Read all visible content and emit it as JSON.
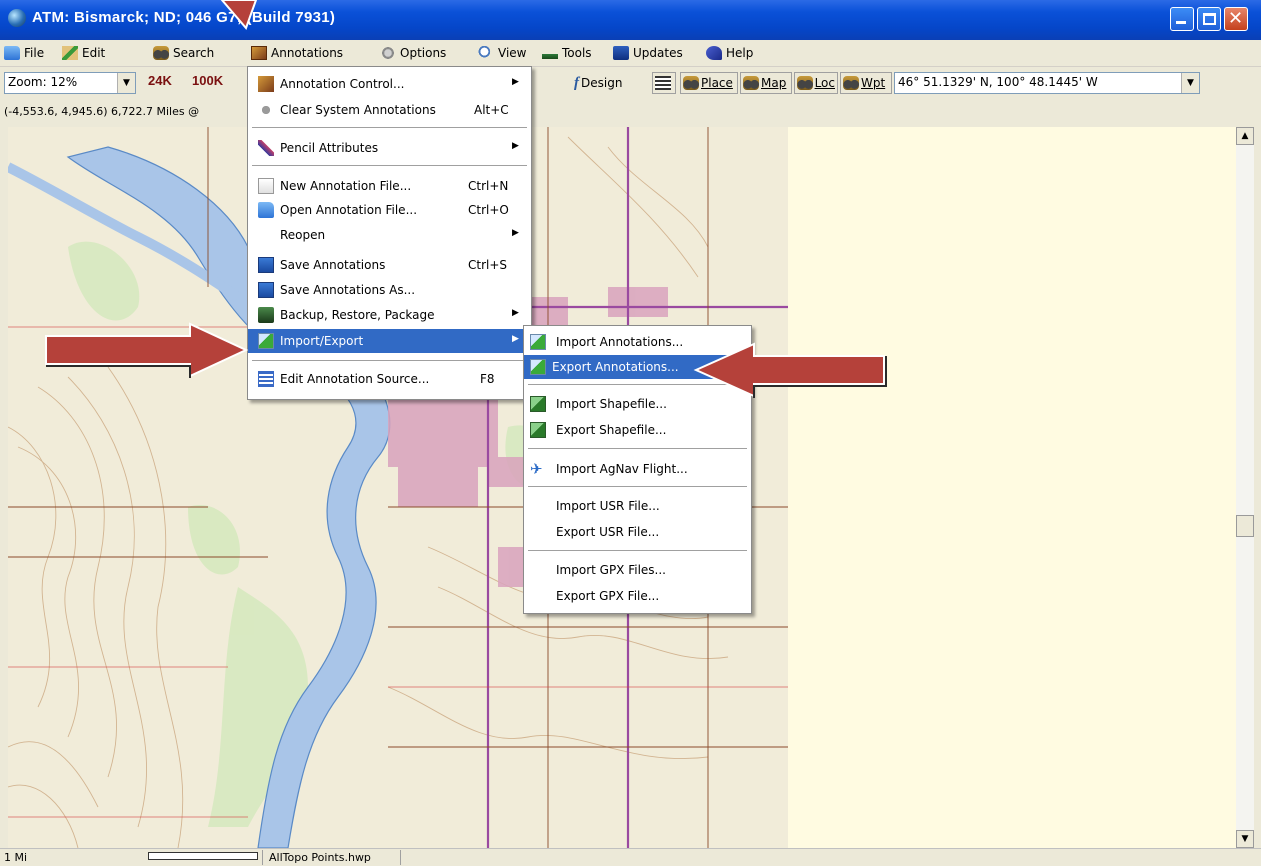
{
  "window": {
    "title": "ATM: Bismarck; ND; 046 G7; (Build 7931)"
  },
  "menubar": {
    "items": [
      {
        "label": "File",
        "icon": "folder-icon"
      },
      {
        "label": "Edit",
        "icon": "edit-icon"
      },
      {
        "label": "Search",
        "icon": "binoculars-icon"
      },
      {
        "label": "Annotations",
        "icon": "annotations-icon"
      },
      {
        "label": "Options",
        "icon": "options-icon"
      },
      {
        "label": "View",
        "icon": "view-icon"
      },
      {
        "label": "Tools",
        "icon": "tools-icon"
      },
      {
        "label": "Updates",
        "icon": "updates-icon"
      },
      {
        "label": "Help",
        "icon": "help-icon"
      }
    ]
  },
  "toolbar": {
    "zoom_value": "Zoom: 12%",
    "scale_24k": "24K",
    "scale_100k": "100K",
    "design_label": "Design",
    "place_label": "Place",
    "map_label": "Map",
    "loc_label": "Loc",
    "wpt_label": "Wpt",
    "coordinate_value": "46° 51.1329' N, 100° 48.1445' W"
  },
  "coord_strip": {
    "text": "(-4,553.6, 4,945.6) 6,722.7 Miles @"
  },
  "annotations_menu": {
    "items": [
      {
        "label": "Annotation Control...",
        "shortcut": "",
        "submenu": true,
        "icon": "annotation-control-icon"
      },
      {
        "label": "Clear System Annotations",
        "shortcut": "Alt+C",
        "submenu": false,
        "icon": "clear-icon"
      },
      {
        "label": "Pencil Attributes",
        "shortcut": "",
        "submenu": true,
        "icon": "pencil-icon"
      },
      {
        "label": "New Annotation File...",
        "shortcut": "Ctrl+N",
        "submenu": false,
        "icon": "new-file-icon"
      },
      {
        "label": "Open Annotation File...",
        "shortcut": "Ctrl+O",
        "submenu": false,
        "icon": "open-folder-icon"
      },
      {
        "label": "Reopen",
        "shortcut": "",
        "submenu": true,
        "icon": ""
      },
      {
        "label": "Save Annotations",
        "shortcut": "Ctrl+S",
        "submenu": false,
        "icon": "save-icon"
      },
      {
        "label": "Save Annotations As...",
        "shortcut": "",
        "submenu": false,
        "icon": "save-as-icon"
      },
      {
        "label": "Backup, Restore, Package",
        "shortcut": "",
        "submenu": true,
        "icon": "backup-icon"
      },
      {
        "label": "Import/Export",
        "shortcut": "",
        "submenu": true,
        "icon": "import-export-icon",
        "highlighted": true
      },
      {
        "label": "Edit Annotation Source...",
        "shortcut": "F8",
        "submenu": false,
        "icon": "edit-source-icon"
      }
    ]
  },
  "import_export_submenu": {
    "items": [
      {
        "label": "Import Annotations...",
        "icon": "import-annotations-icon"
      },
      {
        "label": "Export Annotations...",
        "icon": "export-annotations-icon",
        "highlighted": true
      },
      {
        "label": "Import Shapefile...",
        "icon": "import-shapefile-icon"
      },
      {
        "label": "Export Shapefile...",
        "icon": "export-shapefile-icon"
      },
      {
        "label": "Import AgNav Flight...",
        "icon": "airplane-icon"
      },
      {
        "label": "Import USR File...",
        "icon": ""
      },
      {
        "label": "Export USR File...",
        "icon": ""
      },
      {
        "label": "Import GPX Files...",
        "icon": ""
      },
      {
        "label": "Export GPX File...",
        "icon": ""
      }
    ]
  },
  "statusbar": {
    "scale_label": "1 Mi",
    "file_label": "AllTopo Points.hwp"
  },
  "colors": {
    "titlebar": "#0a51d8",
    "menu_highlight": "#316ac5",
    "annotation_arrow": "#b5413a",
    "map_background": "#fffbe1",
    "river": "#a9c5e8"
  }
}
